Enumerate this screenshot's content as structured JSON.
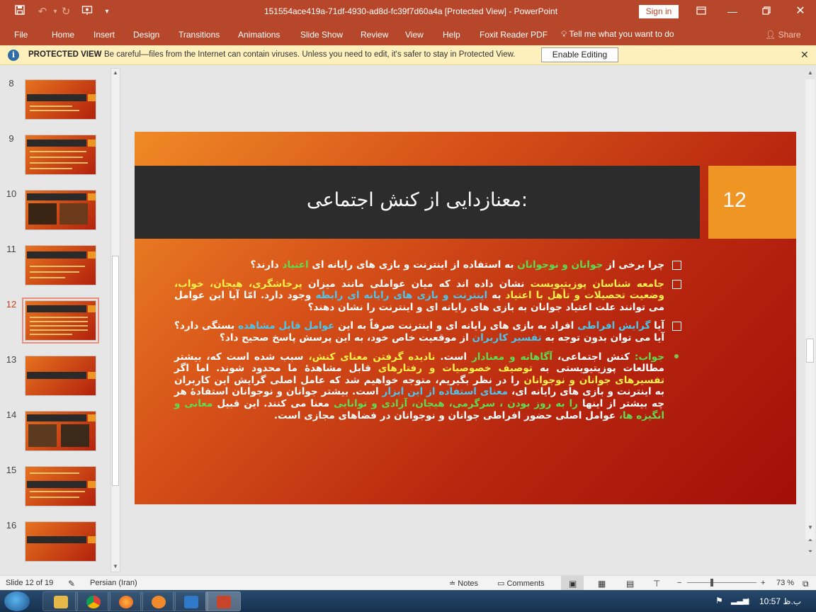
{
  "window": {
    "title": "151554ace419a-71df-4930-ad8d-fc39f7d60a4a [Protected View]  -  PowerPoint",
    "sign_in": "Sign in"
  },
  "menu": {
    "items": [
      "File",
      "Home",
      "Insert",
      "Design",
      "Transitions",
      "Animations",
      "Slide Show",
      "Review",
      "View",
      "Help",
      "Foxit Reader PDF"
    ],
    "tell_me": "Tell me what you want to do",
    "share": "Share"
  },
  "protected_view": {
    "title": "PROTECTED VIEW",
    "message": "Be careful—files from the Internet can contain viruses. Unless you need to edit, it's safer to stay in Protected View.",
    "button": "Enable Editing"
  },
  "thumbnails": [
    "8",
    "9",
    "10",
    "11",
    "12",
    "13",
    "14",
    "15",
    "16"
  ],
  "selected_slide": "12",
  "slide": {
    "number": "12",
    "title": "معنازدایی از کنش اجتماعی:",
    "p1": {
      "a": "چرا برخی از ",
      "b": "جوانان و نوجوانان",
      "c": " به استفاده از اینترنت و بازی های رایانه ای ",
      "d": "اعتیاد",
      "e": " دارند؟"
    },
    "p2": {
      "a": "جامعه شناسان پوزیتیویست",
      "b": " نشان داده اند که میان عواملی مانند میزان ",
      "c": "پرخاشگری، هیجان، خواب، وضعیت تحصیلات و تأهل با اعتیاد",
      "d": " به ",
      "e": "اینترنت و بازی های رایانه ای رابطه",
      "f": " وجود دارد. امّا آیا این عوامل می توانند علت اعتیاد جوانان به بازی های رایانه ای و اینترنت را نشان دهند؟"
    },
    "p3": {
      "a": "آیا ",
      "b": "گرایش افراطی",
      "c": " افراد به بازی های رایانه ای و اینترنت صرفاً به این ",
      "d": "عوامل قابل مشاهده",
      "e": " بستگی دارد؟ آیا می توان بدون توجه به ",
      "f": "تفسیر کاربران",
      "g": " از موقعیت خاص خود، به این پرسش پاسخ صحیح داد؟"
    },
    "p4": {
      "a": "جواب:",
      "b": " کنش اجتماعی، ",
      "c": "آگاهانه و معنادار",
      "d": " است. ",
      "e": "نادیده گرفتن معنای کنش،",
      "f": " سبب شده است که، بیشتر مطالعات پوزیتیویستی به ",
      "g": "توصیف خصوصیات و رفتارهای",
      "h": " قابل مشاهدۀ ما محدود شوند. اما اگر ",
      "i": "تفسیرهای جوانان و نوجوانان",
      "j": " را در نظر بگیریم، متوجه خواهیم شد که عامل اصلی گرایش این کاربران به اینترنت و بازی های رایانه ای، ",
      "k": "معنای استفاده از این ابزار",
      "l": " است. بیشتر جوانان و نوجوانان استفادۀ هر چه بیشتر از اینها ",
      "m": "را به روز بودن ، سرگرمی، هیجان، آزادی و توانایی",
      "n": " معنا می کنند. این قبیل ",
      "o": "معانی و انگیزه ها،",
      "p": " عوامل اصلی حضور افراطی جوانان و نوجوانان در فضاهای مجازی است."
    }
  },
  "status": {
    "slide_of": "Slide 12 of 19",
    "language": "Persian (Iran)",
    "notes": "Notes",
    "comments": "Comments",
    "zoom": "73 %"
  },
  "taskbar": {
    "lang": "ب.ظ",
    "time": "10:57"
  },
  "colors": {
    "accent": "#b7472a",
    "slide_title_bar": "#2d2c2c",
    "slide_number_box": "#ee9523",
    "highlight_yellow": "#fdf04a",
    "highlight_green": "#5fdc52",
    "highlight_cyan": "#49c7ef"
  }
}
